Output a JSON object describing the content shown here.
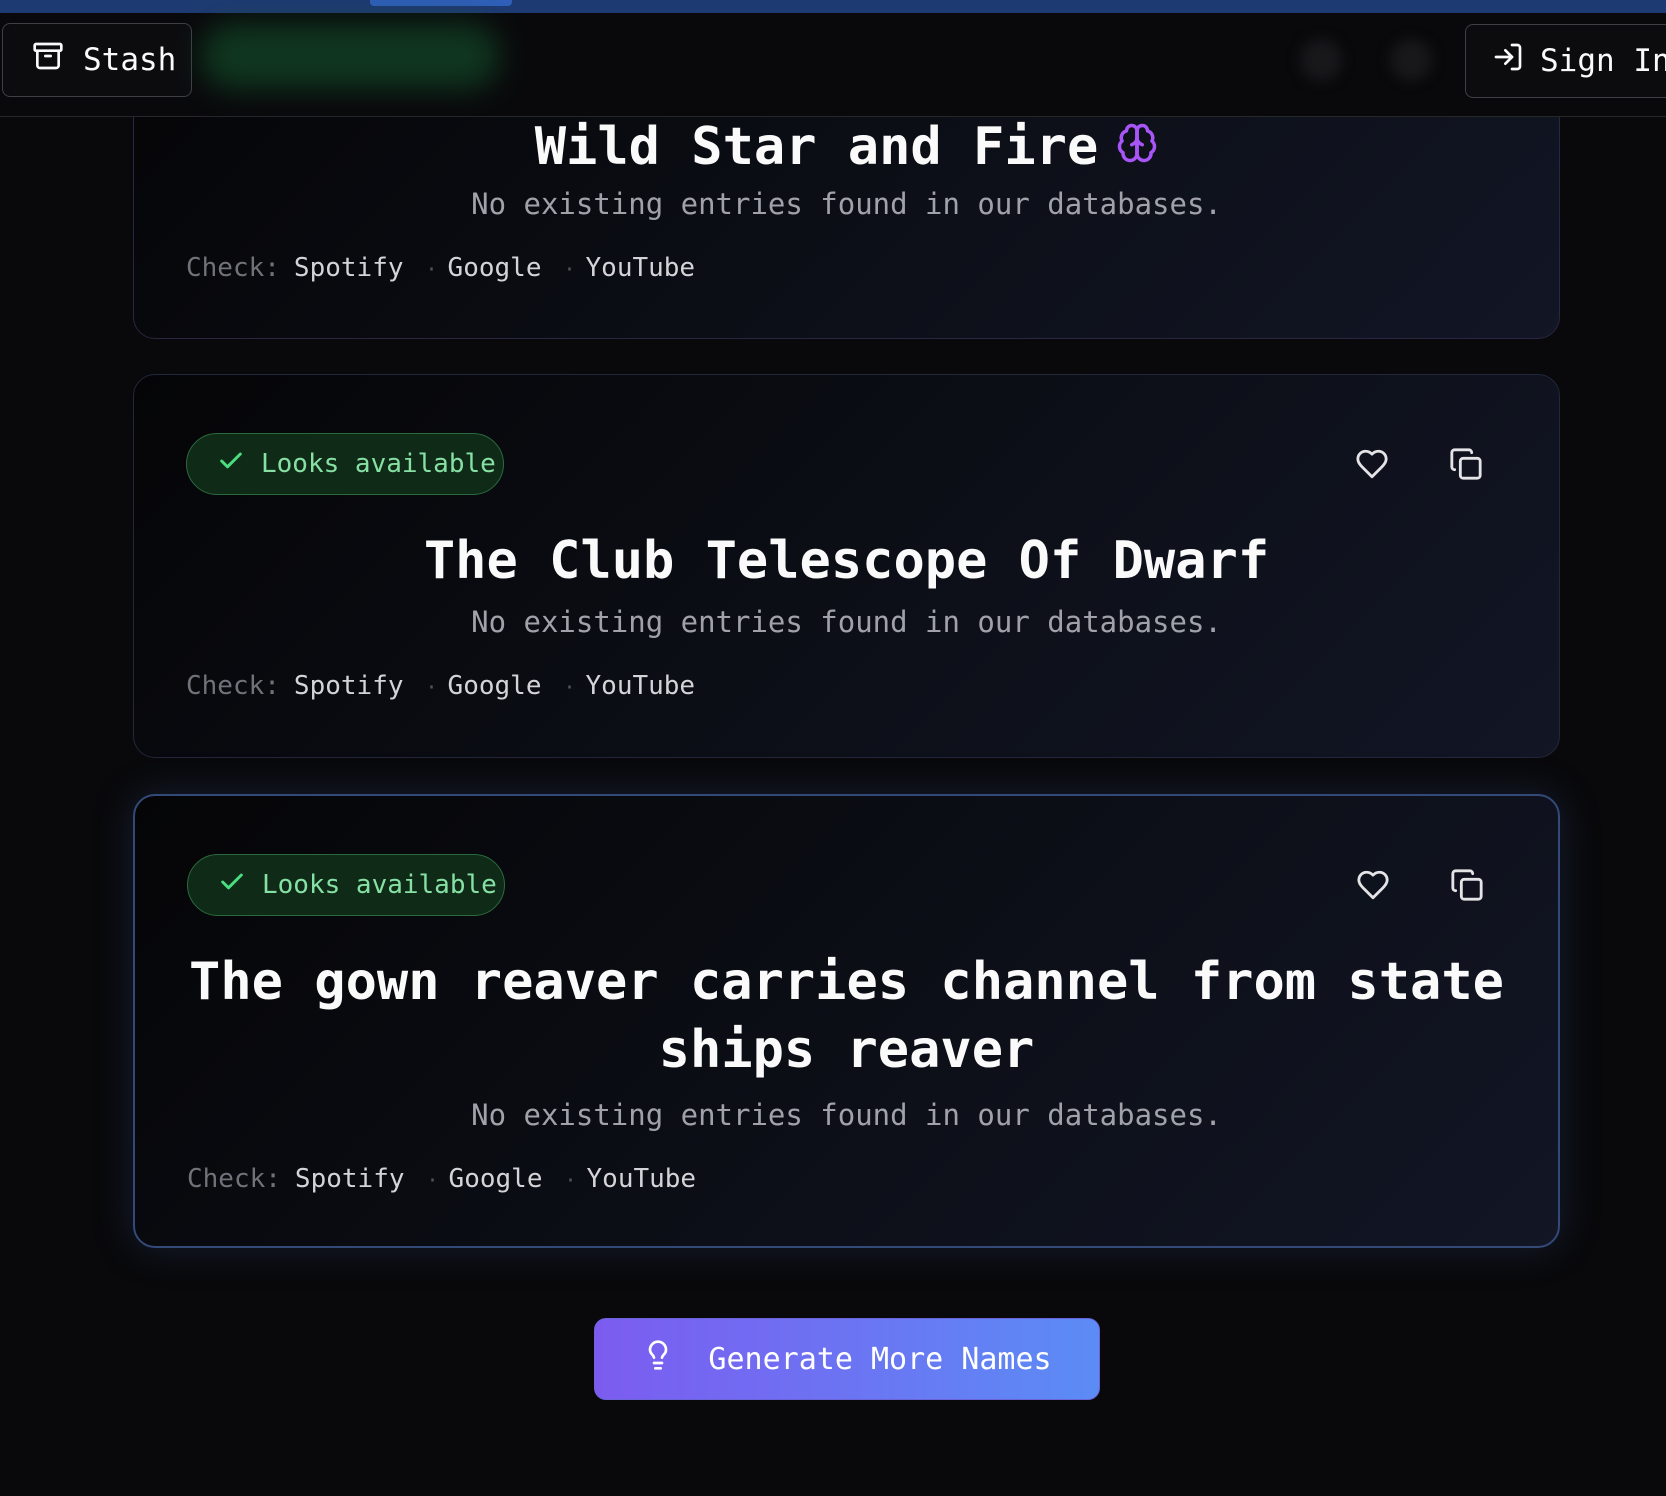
{
  "header": {
    "stash_label": "Stash",
    "signin_label": "Sign In"
  },
  "status_label": "Looks available",
  "check_label": "Check:",
  "links": [
    "Spotify",
    "Google",
    "YouTube"
  ],
  "cards": [
    {
      "title": "Wild Star and Fire",
      "subtitle": "No existing entries found in our databases."
    },
    {
      "title": "The Club Telescope Of Dwarf",
      "subtitle": "No existing entries found in our databases."
    },
    {
      "title": "The gown reaver carries channel from state ships reaver",
      "subtitle": "No existing entries found in our databases."
    }
  ],
  "generate_label": "Generate More Names",
  "colors": {
    "accent_green": "#86e0a3",
    "gradient_start": "#7c5cf0",
    "gradient_end": "#5b8cf5",
    "brain_icon": "#a855f7"
  }
}
